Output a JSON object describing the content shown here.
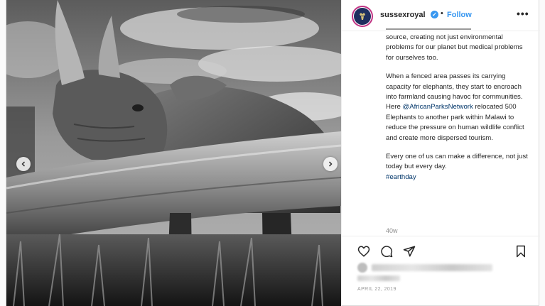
{
  "header": {
    "username": "sussexroyal",
    "separator": "•",
    "follow_label": "Follow",
    "more_label": "•••"
  },
  "caption": {
    "paragraph1": "source, creating not just environmental problems for our planet but medical problems for ourselves too.",
    "paragraph2_before": "When a fenced area passes its carrying capacity for elephants, they start to encroach into farmland causing havoc for communities. Here",
    "paragraph2_link": "@AfricanParksNetwork",
    "paragraph2_after": "relocated 500 Elephants to another park within Malawi to reduce the pressure on human wildlife conflict and create more dispersed tourism.",
    "paragraph3": "Every one of us can make a difference, not just today but every day.",
    "hashtag": "#earthday",
    "time": "40w"
  },
  "footer": {
    "date": "APRIL 22, 2019"
  },
  "icons": {
    "like": "heart-icon",
    "comment": "comment-icon",
    "share": "share-icon",
    "save": "bookmark-icon",
    "prev": "chevron-left-icon",
    "next": "chevron-right-icon",
    "verified": "verified-badge-icon"
  },
  "colors": {
    "link": "#003569",
    "follow": "#3897f0",
    "border": "#dbdbdb"
  }
}
